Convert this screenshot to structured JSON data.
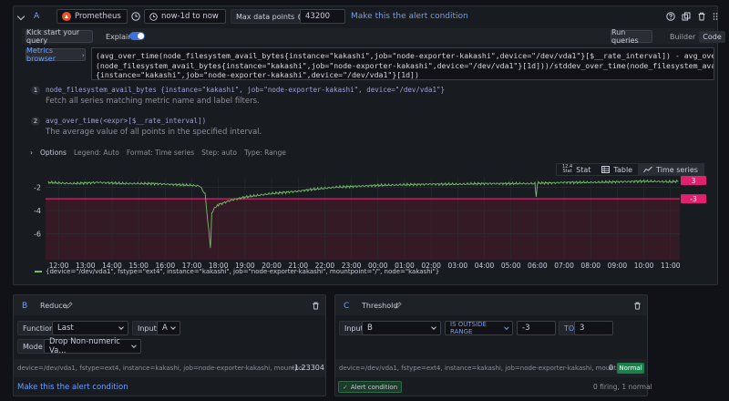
{
  "header": {
    "collapse_icon": "chevron-down-icon",
    "query_letter": "A",
    "datasource": "Prometheus",
    "time_range": "now-1d to now",
    "max_points_label": "Max data points",
    "max_points_value": "43200",
    "alert_link": "Make this the alert condition"
  },
  "toolbar": {
    "kickstart": "Kick start your query",
    "explain": "Explain",
    "run_queries": "Run queries",
    "builder": "Builder",
    "code": "Code"
  },
  "editor": {
    "metrics_browser": "Metrics browser",
    "lines": [
      "(avg_over_time(node_filesystem_avail_bytes{instance=\"kakashi\",job=\"node-exporter-kakashi\",device=\"/dev/vda1\"}[$__rate_interval]) - avg_over_time",
      "(node_filesystem_avail_bytes{instance=\"kakashi\",job=\"node-exporter-kakashi\",device=\"/dev/vda1\"}[1d]))/stddev_over_time(node_filesystem_avail_bytes",
      "{instance=\"kakashi\",job=\"node-exporter-kakashi\",device=\"/dev/vda1\"}[1d])"
    ]
  },
  "explain_steps": [
    {
      "num": "1",
      "expr": "node_filesystem_avail_bytes {instance=\"kakashi\", job=\"node-exporter-kakashi\", device=\"/dev/vda1\"}",
      "desc": "Fetch all series matching metric name and label filters."
    },
    {
      "num": "2",
      "expr": "avg_over_time(<expr>[$__rate_interval])",
      "desc": "The average value of all points in the specified interval."
    }
  ],
  "options": {
    "label": "Options",
    "legend": "Legend: Auto",
    "format": "Format: Time series",
    "step": "Step: auto",
    "type": "Type: Range"
  },
  "view_tabs": {
    "stat": "Stat",
    "table": "Table",
    "timeseries": "Time series",
    "stat_icon_top": "12.4",
    "stat_icon_bottom": "Stat"
  },
  "chart_data": {
    "type": "line",
    "ylim": [
      -8.2,
      -1.2
    ],
    "yticks": [
      "-2",
      "-4",
      "-6"
    ],
    "yticks_values": [
      -2,
      -4,
      -6
    ],
    "xlim": [
      11.5,
      35.35
    ],
    "xticks": [
      "12:00",
      "13:00",
      "14:00",
      "15:00",
      "16:00",
      "17:00",
      "18:00",
      "19:00",
      "20:00",
      "21:00",
      "22:00",
      "23:00",
      "00:00",
      "01:00",
      "02:00",
      "03:00",
      "04:00",
      "05:00",
      "06:00",
      "07:00",
      "08:00",
      "09:00",
      "10:00",
      "11:00"
    ],
    "threshold_high": 3,
    "threshold_low": -3,
    "threshold_high_label": "3",
    "threshold_low_label": "-3",
    "series": [
      {
        "name": "{device=\"/dev/vda1\", fstype=\"ext4\", instance=\"kakashi\", job=\"node-exporter-kakashi\", mountpoint=\"/\", node=\"kakashi\"}",
        "color": "#73bf69",
        "x": [
          11.6,
          12.0,
          12.5,
          13.0,
          13.5,
          14.0,
          14.5,
          15.0,
          15.5,
          16.0,
          16.5,
          17.0,
          17.3,
          17.5,
          17.7,
          17.75,
          17.85,
          18.0,
          18.5,
          19.0,
          19.5,
          20.0,
          20.5,
          21.0,
          21.5,
          22.0,
          22.5,
          23.0,
          24.0,
          25.0,
          26.0,
          27.0,
          28.0,
          29.0,
          29.9,
          29.95,
          30.0,
          30.5,
          31.0,
          32.0,
          33.0,
          34.0,
          35.0,
          35.3
        ],
        "y": [
          -1.6,
          -1.65,
          -1.7,
          -1.65,
          -1.6,
          -1.65,
          -1.7,
          -1.7,
          -1.7,
          -1.75,
          -1.8,
          -1.85,
          -1.9,
          -2.6,
          -7.2,
          -4.2,
          -3.8,
          -3.5,
          -3.1,
          -2.85,
          -2.7,
          -2.55,
          -2.45,
          -2.35,
          -2.2,
          -2.1,
          -2.0,
          -1.95,
          -1.85,
          -1.8,
          -1.75,
          -1.75,
          -1.7,
          -1.7,
          -1.7,
          -2.9,
          -1.65,
          -1.65,
          -1.6,
          -1.6,
          -1.55,
          -1.5,
          -1.55,
          -1.5
        ]
      }
    ],
    "colors": {
      "line": "#73bf69",
      "threshold": "#e0226e",
      "band": "#3a1a26"
    }
  },
  "expr_b": {
    "letter": "B",
    "title": "Reduce",
    "function_label": "Function",
    "function_value": "Last",
    "input_label": "Input",
    "input_value": "A",
    "mode_label": "Mode",
    "mode_value": "Drop Non-numeric Va...",
    "row_labels": "device=/dev/vda1, fstype=ext4, instance=kakashi, job=node-exporter-kakashi, mountpoi...",
    "row_value": "-1.23304",
    "alert_link": "Make this the alert condition"
  },
  "expr_c": {
    "letter": "C",
    "title": "Threshold",
    "input_label": "Input",
    "input_value": "B",
    "condition": "IS OUTSIDE RANGE",
    "low_value": "-3",
    "to_label": "TO",
    "high_value": "3",
    "row_labels": "device=/dev/vda1, fstype=ext4, instance=kakashi, job=node-exporter-kakashi, mountpoi...",
    "row_value": "0",
    "status_badge": "Normal",
    "alert_condition": "Alert condition",
    "firing_summary": "0 firing, 1 normal"
  }
}
